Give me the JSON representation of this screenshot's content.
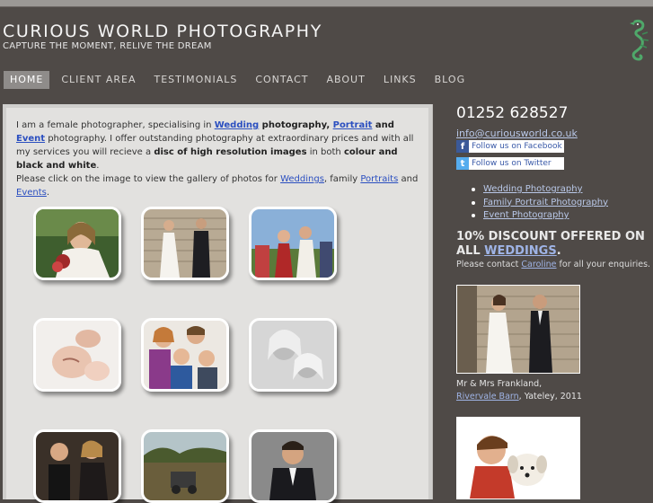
{
  "header": {
    "title": "CURIOUS WORLD PHOTOGRAPHY",
    "tagline": "CAPTURE THE MOMENT, RELIVE THE DREAM",
    "logo_icon": "seahorse-logo-icon"
  },
  "nav": {
    "items": [
      {
        "label": "HOME",
        "active": true
      },
      {
        "label": "CLIENT AREA"
      },
      {
        "label": "TESTIMONIALS"
      },
      {
        "label": "CONTACT"
      },
      {
        "label": "ABOUT"
      },
      {
        "label": "LINKS"
      },
      {
        "label": "BLOG"
      }
    ]
  },
  "intro": {
    "p1_a": "I am a female photographer, specialising in ",
    "wedding": "Wedding",
    "photography_b": " photography, ",
    "portrait": "Portrait",
    "and": " and ",
    "event": "Event",
    "p1_b": " photography. I offer outstanding photography at extraordinary prices and with all my services you will recieve a ",
    "disc": "disc of high resolution images",
    "in_both": " in both ",
    "colour": "colour and black and white",
    "period": ".",
    "p2_a": "Please click on the image to view the gallery of photos for ",
    "weddings": "Weddings",
    "family": ", family ",
    "portraits": "Portraits",
    "and2": " and ",
    "events": "Events",
    "period2": "."
  },
  "sidebar": {
    "phone": "01252 628527",
    "email": "info@curiousworld.co.uk",
    "facebook_label": "Follow us on Facebook",
    "twitter_label": "Follow us on Twitter",
    "links": [
      "Wedding Photography",
      "Family Portrait Photography",
      "Event Photography"
    ],
    "discount_a": "10% DISCOUNT OFFERED ON ALL ",
    "discount_link": "WEDDINGS",
    "discount_b": ".",
    "enquiry_a": "Please contact ",
    "enquiry_link": "Caroline",
    "enquiry_b": " for all your enquiries.",
    "caption1_line1": "Mr & Mrs Frankland,",
    "caption1_link": "Rivervale Barn",
    "caption1_rest": ", Yateley, 2011"
  },
  "colors": {
    "background": "#4f4a47",
    "panel": "#e2e1df",
    "link": "#2b4fc0",
    "nav_active": "#8f8c8a"
  }
}
